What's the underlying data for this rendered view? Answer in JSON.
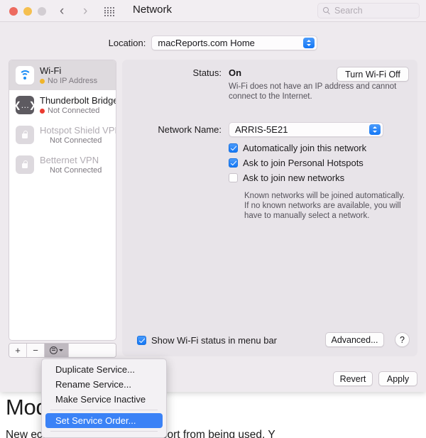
{
  "window": {
    "toolbar": {
      "title": "Network",
      "back_icon": "chevron-left-icon",
      "forward_icon": "chevron-right-icon",
      "grid_icon": "grid-apps-icon",
      "search_placeholder": "Search",
      "search_value": ""
    },
    "location": {
      "label": "Location:",
      "value": "macReports.com Home"
    },
    "sidebar": {
      "services": [
        {
          "name": "Wi-Fi",
          "status": "No IP Address",
          "status_color": "#f0b429",
          "icon": "wifi-icon",
          "selected": true,
          "dimmed": false
        },
        {
          "name": "Thunderbolt Bridge",
          "status": "Not Connected",
          "status_color": "#eb3b30",
          "icon": "thunderbolt-bridge-icon",
          "selected": false,
          "dimmed": false
        },
        {
          "name": "Hotspot Shield VPN",
          "status": "Not Connected",
          "status_color": "",
          "icon": "lock-icon",
          "selected": false,
          "dimmed": true
        },
        {
          "name": "Betternet VPN",
          "status": "Not Connected",
          "status_color": "",
          "icon": "lock-icon",
          "selected": false,
          "dimmed": true
        }
      ],
      "footer": {
        "add_label": "+",
        "remove_label": "−",
        "action_icon": "gear-icon",
        "action_caret_icon": "chevron-down-icon"
      }
    },
    "detail": {
      "status_label": "Status:",
      "status_value": "On",
      "status_description": "Wi-Fi does not have an IP address and cannot connect to the Internet.",
      "turn_off_label": "Turn Wi-Fi Off",
      "network_name_label": "Network Name:",
      "network_name_value": "ARRIS-5E21",
      "checkboxes": [
        {
          "label": "Automatically join this network",
          "checked": true
        },
        {
          "label": "Ask to join Personal Hotspots",
          "checked": true
        },
        {
          "label": "Ask to join new networks",
          "checked": false
        }
      ],
      "hint": "Known networks will be joined automatically. If no known networks are available, you will have to manually select a network.",
      "show_status_label": "Show Wi-Fi status in menu bar",
      "show_status_checked": true,
      "advanced_label": "Advanced...",
      "help_label": "?"
    },
    "actions": {
      "revert_label": "Revert",
      "apply_label": "Apply"
    }
  },
  "context_menu": {
    "items": [
      {
        "label": "Duplicate Service...",
        "highlighted": false,
        "separator_after": false
      },
      {
        "label": "Rename Service...",
        "highlighted": false,
        "separator_after": false
      },
      {
        "label": "Make Service Inactive",
        "highlighted": false,
        "separator_after": true
      },
      {
        "label": "Set Service Order...",
        "highlighted": true,
        "separator_after": true
      }
    ]
  },
  "background_page": {
    "heading": "Mod                        ns",
    "paragraph": "New                                ections. You can disable a port from being used. Y"
  },
  "colors": {
    "accent_blue": "#1477f5",
    "highlight_blue": "#3b82f6",
    "warning_amber": "#f0b429",
    "error_red": "#eb3b30",
    "window_bg": "#eeeaee",
    "panel_bg": "#e8e4e9"
  }
}
